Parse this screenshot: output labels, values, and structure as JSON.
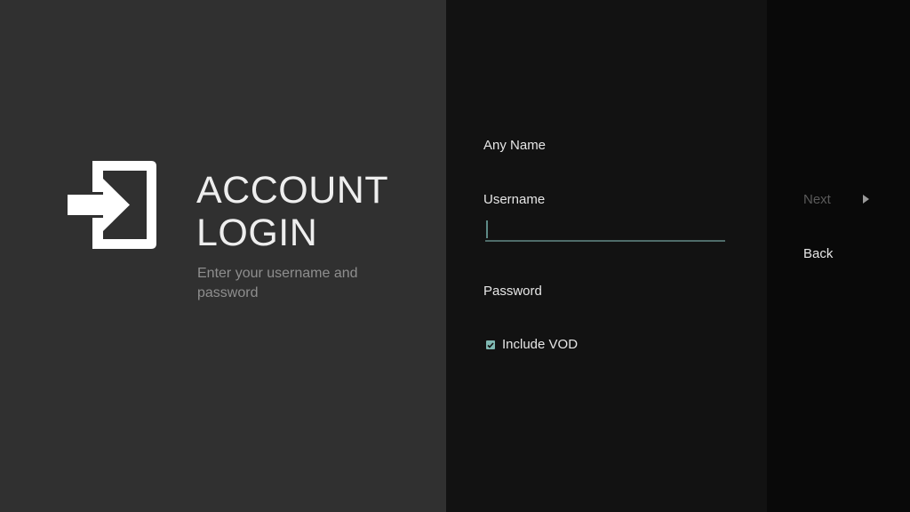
{
  "header": {
    "title_line1": "ACCOUNT",
    "title_line2": "LOGIN",
    "subtitle": "Enter your username and password",
    "icon": "login-icon"
  },
  "form": {
    "name_label": "Any Name",
    "username_label": "Username",
    "username_value": "",
    "password_label": "Password",
    "include_vod_label": "Include VOD",
    "include_vod_checked": true
  },
  "actions": {
    "next_label": "Next",
    "back_label": "Back"
  },
  "colors": {
    "accent": "#7fb8b2",
    "underline": "#4f6c6a",
    "left_panel": "#303030",
    "middle_panel": "#121212",
    "right_panel": "#090909",
    "disabled_text": "#5a5a5a"
  }
}
